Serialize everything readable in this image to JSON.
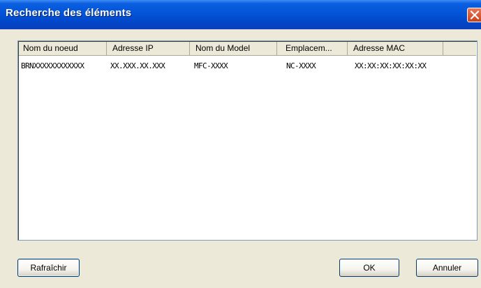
{
  "window": {
    "title": "Recherche des éléments"
  },
  "list": {
    "columns": [
      "Nom du noeud",
      "Adresse IP",
      "Nom du Model",
      "Emplacem...",
      "Adresse MAC"
    ],
    "rows": [
      [
        "BRNXXXXXXXXXXXX",
        "XX.XXX.XX.XXX",
        "MFC-XXXX",
        "NC-XXXX",
        "XX:XX:XX:XX:XX:XX"
      ]
    ]
  },
  "buttons": {
    "refresh": "Rafraîchir",
    "ok": "OK",
    "cancel": "Annuler"
  }
}
